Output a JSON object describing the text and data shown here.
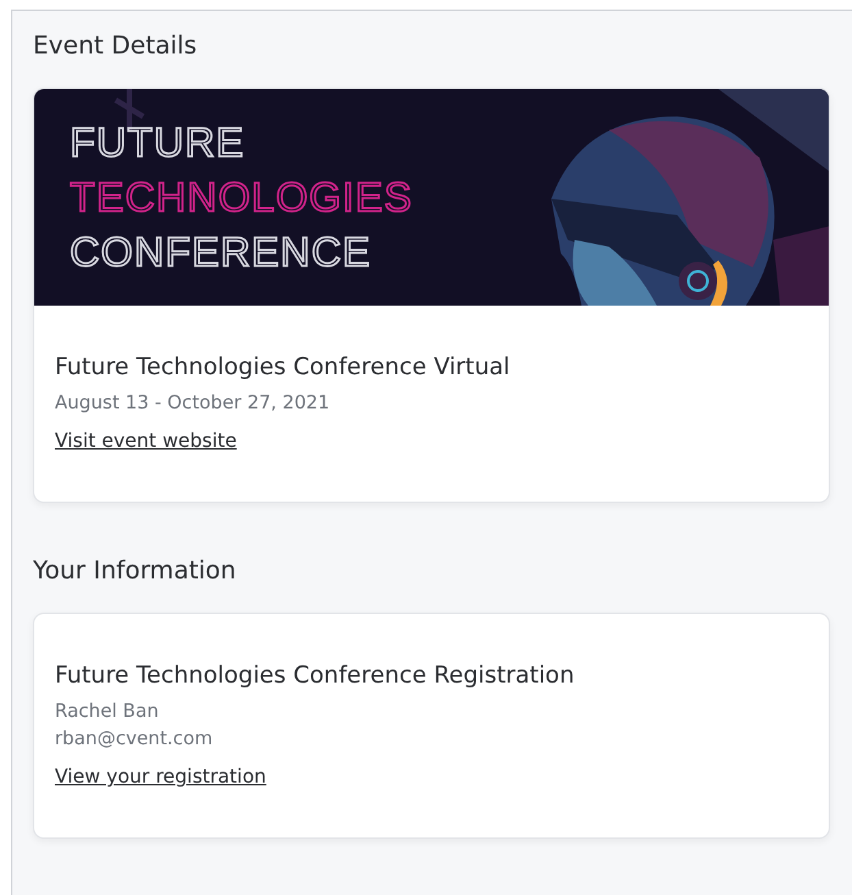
{
  "sections": [
    {
      "heading": "Event Details",
      "card": {
        "banner": {
          "lines": [
            {
              "text": "FUTURE",
              "accent": false
            },
            {
              "text": "TECHNOLOGIES",
              "accent": true
            },
            {
              "text": "CONFERENCE",
              "accent": false
            }
          ]
        },
        "title": "Future Technologies Conference Virtual",
        "details": [
          "August 13 - October 27, 2021"
        ],
        "link": "Visit event website"
      }
    },
    {
      "heading": "Your Information",
      "card": {
        "title": "Future Technologies Conference Registration",
        "details": [
          "Rachel Ban",
          "rban@cvent.com"
        ],
        "link": "View your registration"
      }
    }
  ]
}
